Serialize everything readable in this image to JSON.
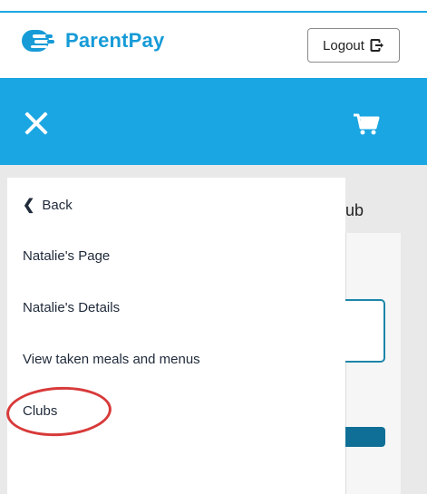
{
  "header": {
    "brand": "ParentPay",
    "logout_label": "Logout"
  },
  "background_page": {
    "partial_text": "ub"
  },
  "menu": {
    "back_label": "Back",
    "items": [
      "Natalie's Page",
      "Natalie's Details",
      "View taken meals and menus",
      "Clubs"
    ]
  },
  "colors": {
    "brand_blue": "#1aa6e2",
    "logo_blue": "#169bd7",
    "highlight_red": "#d83a3a"
  }
}
